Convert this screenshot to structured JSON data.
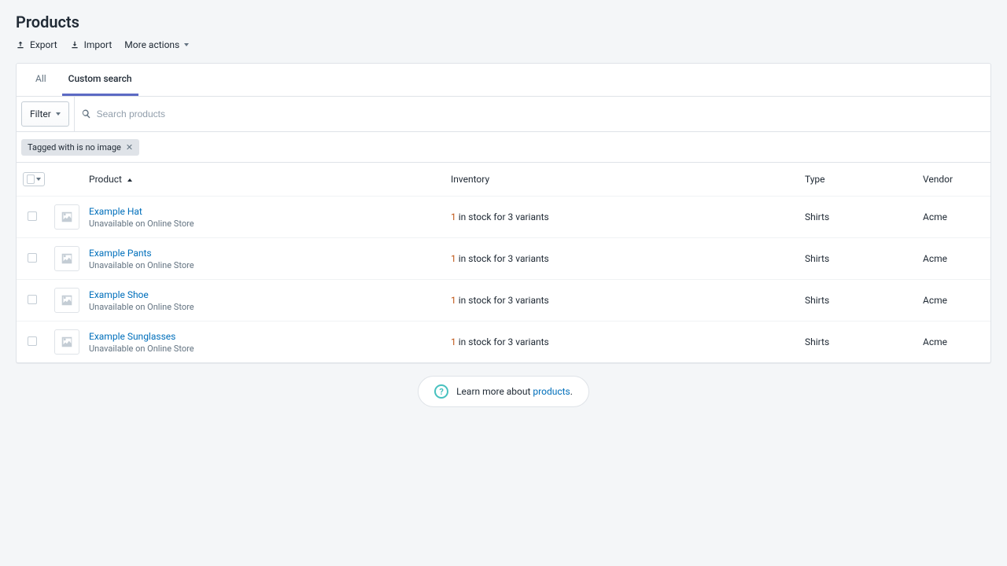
{
  "header": {
    "title": "Products",
    "actions": {
      "export": "Export",
      "import": "Import",
      "more": "More actions"
    }
  },
  "tabs": {
    "all": "All",
    "custom": "Custom search"
  },
  "filters": {
    "button": "Filter",
    "search_placeholder": "Search products",
    "chip": "Tagged with is no image"
  },
  "table": {
    "headers": {
      "product": "Product",
      "inventory": "Inventory",
      "type": "Type",
      "vendor": "Vendor"
    },
    "rows": [
      {
        "name": "Example Hat",
        "sub": "Unavailable on Online Store",
        "inv_count": "1",
        "inv_text": " in stock for 3 variants",
        "type": "Shirts",
        "vendor": "Acme"
      },
      {
        "name": "Example Pants",
        "sub": "Unavailable on Online Store",
        "inv_count": "1",
        "inv_text": " in stock for 3 variants",
        "type": "Shirts",
        "vendor": "Acme"
      },
      {
        "name": "Example Shoe",
        "sub": "Unavailable on Online Store",
        "inv_count": "1",
        "inv_text": " in stock for 3 variants",
        "type": "Shirts",
        "vendor": "Acme"
      },
      {
        "name": "Example Sunglasses",
        "sub": "Unavailable on Online Store",
        "inv_count": "1",
        "inv_text": " in stock for 3 variants",
        "type": "Shirts",
        "vendor": "Acme"
      }
    ]
  },
  "help": {
    "prefix": "Learn more about ",
    "link": "products",
    "suffix": "."
  }
}
